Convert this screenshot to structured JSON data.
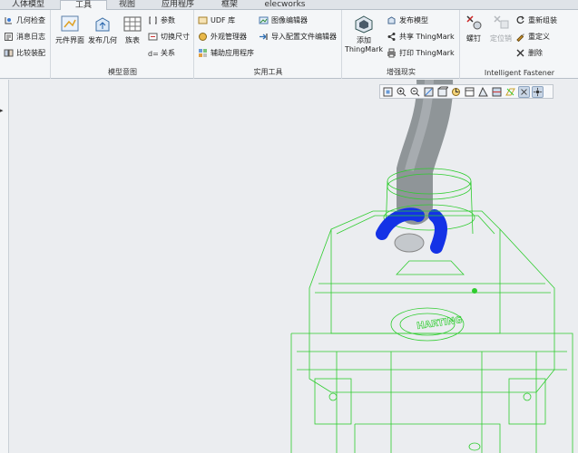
{
  "tabs": [
    {
      "label": "人体模型",
      "active": false
    },
    {
      "label": "工具",
      "active": true
    },
    {
      "label": "视图",
      "active": false
    },
    {
      "label": "应用程序",
      "active": false
    },
    {
      "label": "框架",
      "active": false
    },
    {
      "label": "elecworks",
      "active": false
    }
  ],
  "ribbon": {
    "investigate": {
      "items": [
        "几何检查",
        "消息日志",
        "比较装配"
      ]
    },
    "model_intent": {
      "label": "模型意图",
      "big_buttons": [
        "元件界面",
        "发布几何",
        "族表"
      ],
      "small_items": [
        "参数",
        "切换尺寸",
        "关系"
      ]
    },
    "utilities": {
      "label": "实用工具",
      "items_left": [
        "UDF 库",
        "外观管理器",
        "辅助应用程序"
      ],
      "items_right": [
        "图像编辑器",
        "导入配置文件编辑器"
      ]
    },
    "thingmark": {
      "label": "增强现实",
      "big_button": "添加\nThingMark",
      "items": [
        "发布模型",
        "共享 ThingMark",
        "打印 ThingMark"
      ]
    },
    "fastener": {
      "label": "Intelligent Fastener",
      "big_buttons": [
        "螺钉",
        "定位销"
      ],
      "items": [
        "重新组装",
        "重定义",
        "删除"
      ]
    }
  },
  "viewport": {
    "model_text": "HARTING"
  },
  "colors": {
    "wire": "#2ecc2e",
    "blue": "#1432e6",
    "cable": "#8f9598"
  }
}
